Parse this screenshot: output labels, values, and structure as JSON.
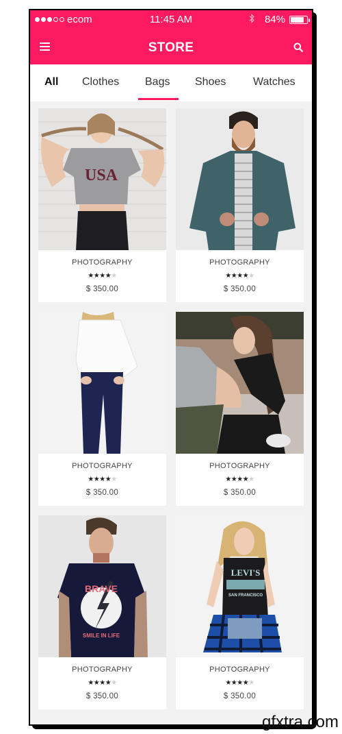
{
  "status_bar": {
    "carrier": "ecom",
    "signal_strength": 3,
    "signal_max": 5,
    "time": "11:45 AM",
    "bluetooth_icon": "bluetooth-icon",
    "battery_percent_label": "84%",
    "battery_level": 0.84
  },
  "header": {
    "title": "STORE",
    "menu_icon": "hamburger-menu-icon",
    "search_icon": "search-icon",
    "accent_color": "#FE1A60"
  },
  "tabs": {
    "items": [
      {
        "label": "All"
      },
      {
        "label": "Clothes"
      },
      {
        "label": "Bags"
      },
      {
        "label": "Shoes"
      },
      {
        "label": "Watches"
      }
    ],
    "active": "Bags"
  },
  "products": [
    {
      "category": "PHOTOGRAPHY",
      "rating": 4,
      "rating_max": 5,
      "price": "$ 350.00",
      "image": "woman in grey USA crop tee pulling braids"
    },
    {
      "category": "PHOTOGRAPHY",
      "rating": 4,
      "rating_max": 5,
      "price": "$ 350.00",
      "image": "bearded man in teal blazer and striped tee"
    },
    {
      "category": "PHOTOGRAPHY",
      "rating": 4,
      "rating_max": 5,
      "price": "$ 350.00",
      "image": "woman in white shirt and navy skinny jeans"
    },
    {
      "category": "PHOTOGRAPHY",
      "rating": 4,
      "rating_max": 5,
      "price": "$ 350.00",
      "image": "woman in grey tank seated outdoors"
    },
    {
      "category": "PHOTOGRAPHY",
      "rating": 4,
      "rating_max": 5,
      "price": "$ 350.00",
      "image": "tattooed man in navy BRAVE graphic tee"
    },
    {
      "category": "PHOTOGRAPHY",
      "rating": 4,
      "rating_max": 5,
      "price": "$ 350.00",
      "image": "blonde woman in black LEVI'S San Francisco tank with plaid shirt"
    }
  ],
  "image_text": {
    "p1_shirt": "USA",
    "p5_shirt_top": "BRAVE",
    "p5_shirt_bottom": "SMILE IN LIFE",
    "p6_shirt_top": "LEVI'S",
    "p6_shirt_bottom": "SAN FRANCISCO"
  },
  "watermark": "gfxtra.com"
}
